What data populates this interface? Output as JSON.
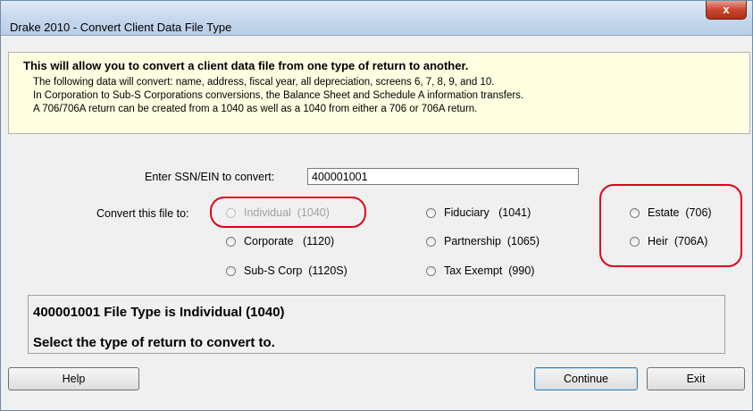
{
  "window": {
    "title": "Drake 2010 - Convert Client Data File Type",
    "close_label": "x"
  },
  "info": {
    "heading": "This will allow you to convert a client data file from one type of return to another.",
    "lines": [
      "The following data will convert: name, address, fiscal year, all depreciation, screens 6, 7, 8, 9, and 10.",
      "In Corporation to Sub-S Corporations conversions, the Balance Sheet and Schedule A information transfers.",
      "A 706/706A return can be created from a 1040 as well as a 1040 from either a 706 or 706A return."
    ]
  },
  "form": {
    "ssn_label": "Enter SSN/EIN to convert:",
    "ssn_value": "400001001",
    "convert_label": "Convert this file to:",
    "options": [
      {
        "label": "Individual  (1040)",
        "disabled": true
      },
      {
        "label": "Corporate   (1120)",
        "disabled": false
      },
      {
        "label": "Sub-S Corp  (1120S)",
        "disabled": false
      },
      {
        "label": "Fiduciary   (1041)",
        "disabled": false
      },
      {
        "label": "Partnership  (1065)",
        "disabled": false
      },
      {
        "label": "Tax Exempt  (990)",
        "disabled": false
      },
      {
        "label": "Estate  (706)",
        "disabled": false
      },
      {
        "label": "Heir  (706A)",
        "disabled": false
      }
    ]
  },
  "status": {
    "line1": "400001001 File Type is Individual (1040)",
    "line2": "Select the type of return to convert to."
  },
  "buttons": {
    "help": "Help",
    "continue": "Continue",
    "exit": "Exit"
  },
  "colors": {
    "info_background": "#ffffe1",
    "highlight": "#e2001a"
  }
}
